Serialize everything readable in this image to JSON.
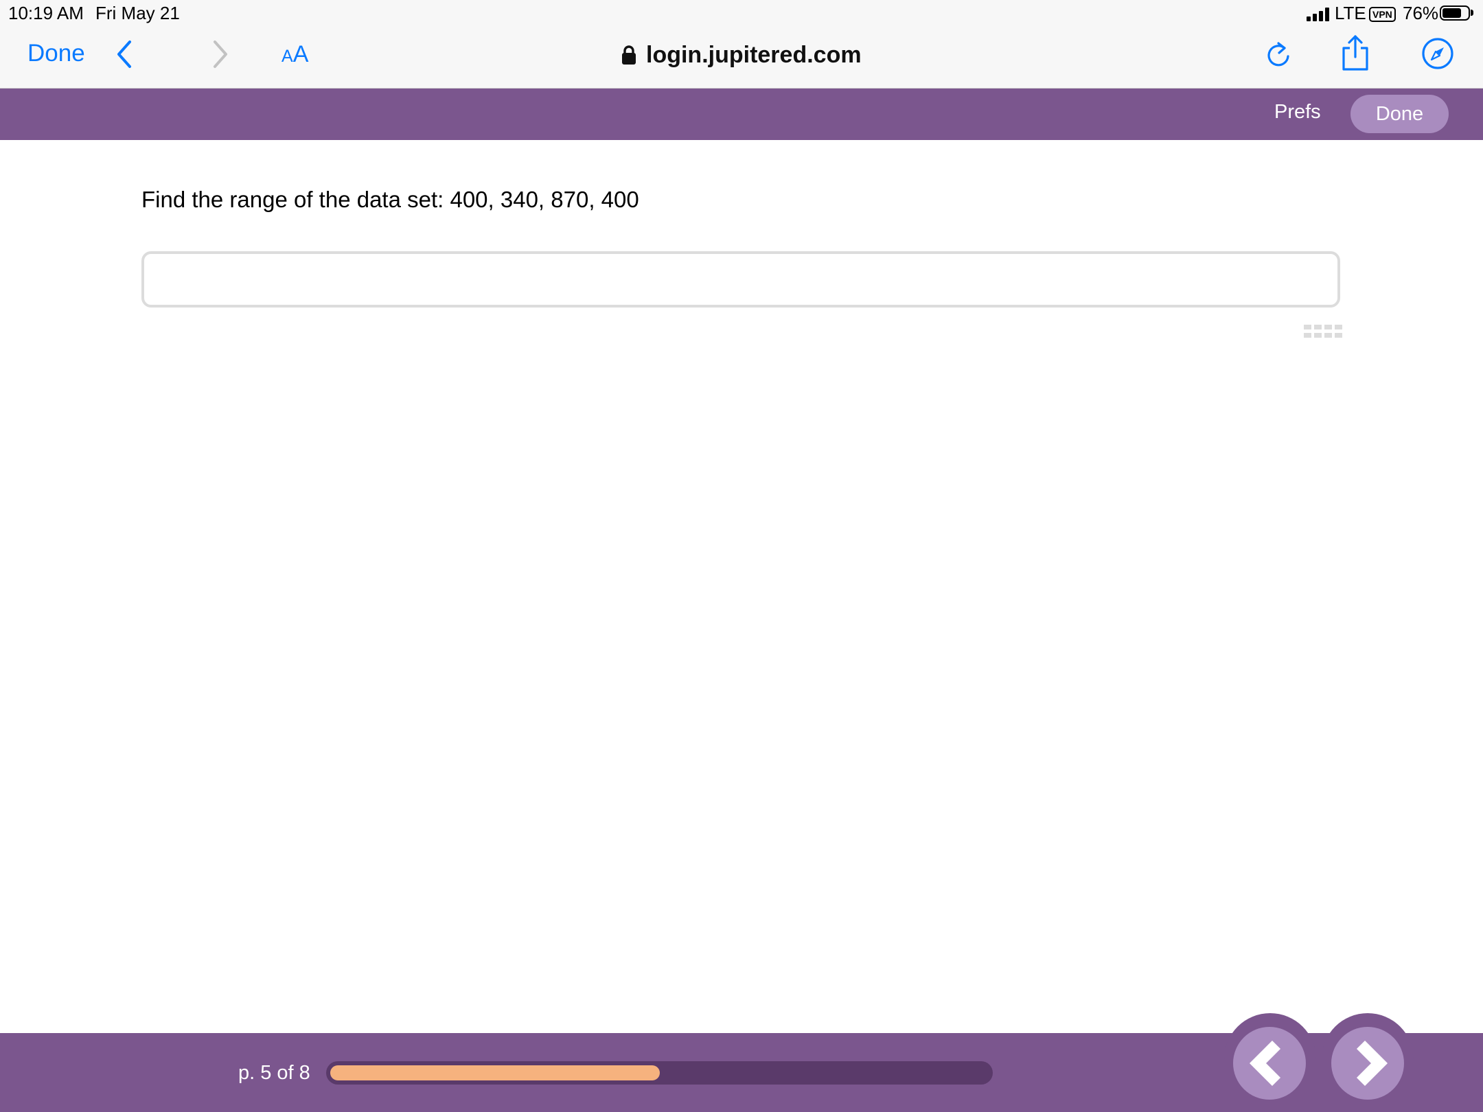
{
  "status_bar": {
    "time": "10:19 AM",
    "date": "Fri May 21",
    "carrier": "LTE",
    "vpn": "VPN",
    "battery_percent": "76%",
    "battery_level": 0.76
  },
  "browser": {
    "done_label": "Done",
    "text_size_small": "A",
    "text_size_big": "A",
    "url": "login.jupitered.com",
    "accent_color": "#0a7aff",
    "icons": [
      "chevron-left-icon",
      "chevron-right-icon",
      "text-size-icon",
      "lock-icon",
      "reload-icon",
      "share-icon",
      "safari-compass-icon"
    ]
  },
  "app_header": {
    "prefs_label": "Prefs",
    "done_label": "Done",
    "color": "#7b568e"
  },
  "main": {
    "question": "Find the range of the data set: 400, 340, 870, 400",
    "answer_value": "",
    "answer_placeholder": ""
  },
  "footer": {
    "page_label": "p. 5 of 8",
    "progress": 0.5,
    "progress_color": "#f6b27e"
  }
}
